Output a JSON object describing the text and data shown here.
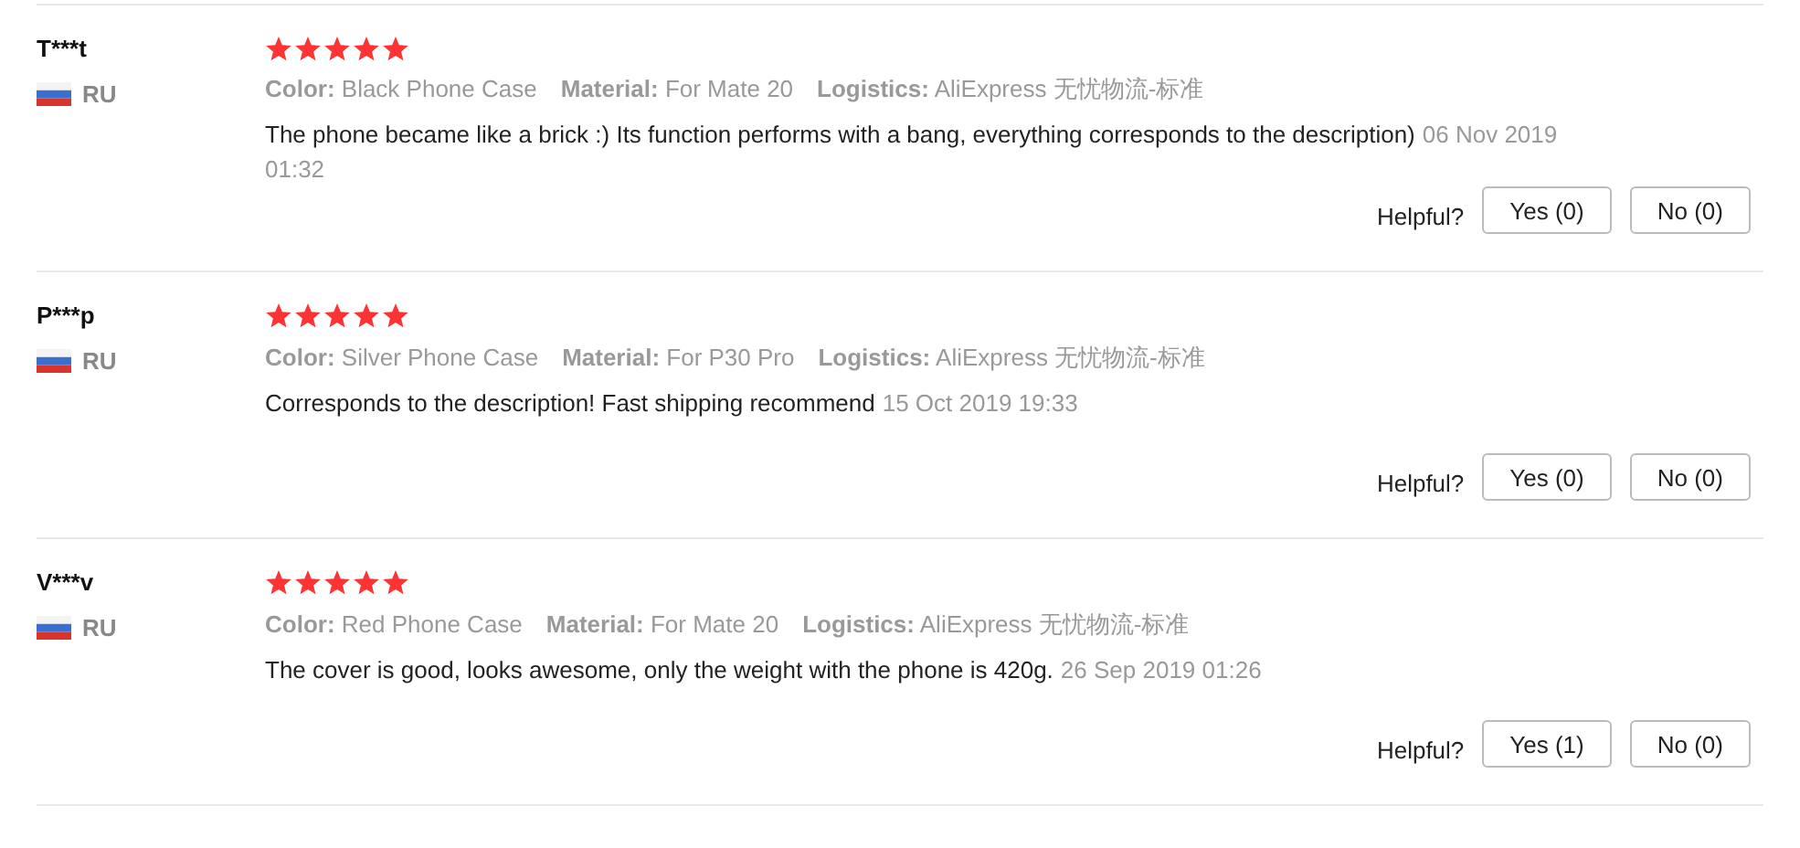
{
  "reviews": [
    {
      "user": "T***t",
      "country": "RU",
      "stars": 5,
      "attributes": [
        {
          "label": "Color:",
          "value": "Black Phone Case"
        },
        {
          "label": "Material:",
          "value": "For Mate 20"
        },
        {
          "label": "Logistics:",
          "value": "AliExpress 无忧物流-标准"
        }
      ],
      "text": "The phone became like a brick :) Its function performs with a bang, everything corresponds to the description)",
      "date": "06 Nov 2019 01:32",
      "helpful_label": "Helpful?",
      "yes": "Yes (0)",
      "no": "No (0)"
    },
    {
      "user": "P***p",
      "country": "RU",
      "stars": 5,
      "attributes": [
        {
          "label": "Color:",
          "value": "Silver Phone Case"
        },
        {
          "label": "Material:",
          "value": "For P30 Pro"
        },
        {
          "label": "Logistics:",
          "value": "AliExpress 无忧物流-标准"
        }
      ],
      "text": "Corresponds to the description! Fast shipping recommend",
      "date": "15 Oct 2019 19:33",
      "helpful_label": "Helpful?",
      "yes": "Yes (0)",
      "no": "No (0)"
    },
    {
      "user": "V***v",
      "country": "RU",
      "stars": 5,
      "attributes": [
        {
          "label": "Color:",
          "value": "Red Phone Case"
        },
        {
          "label": "Material:",
          "value": "For Mate 20"
        },
        {
          "label": "Logistics:",
          "value": "AliExpress 无忧物流-标准"
        }
      ],
      "text": "The cover is good, looks awesome, only the weight with the phone is 420g.",
      "date": "26 Sep 2019 01:26",
      "helpful_label": "Helpful?",
      "yes": "Yes (1)",
      "no": "No (0)"
    }
  ]
}
